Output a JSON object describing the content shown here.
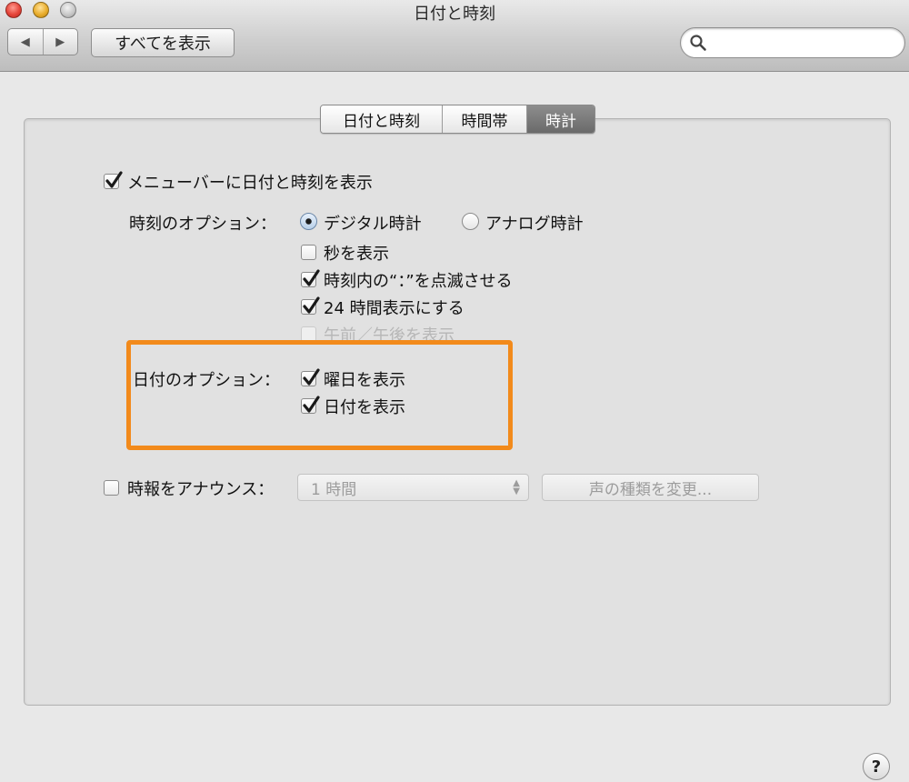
{
  "window": {
    "title": "日付と時刻"
  },
  "toolbar": {
    "back_icon": "◀",
    "forward_icon": "▶",
    "show_all_label": "すべてを表示",
    "search_placeholder": "",
    "search_value": ""
  },
  "tabs": [
    {
      "label": "日付と時刻",
      "active": false
    },
    {
      "label": "時間帯",
      "active": false
    },
    {
      "label": "時計",
      "active": true
    }
  ],
  "clock": {
    "menubar_checkbox": {
      "label": "メニューバーに日付と時刻を表示",
      "checked": true
    },
    "time_options_label": "時刻のオプション：",
    "digital_radio": {
      "label": "デジタル時計",
      "selected": true
    },
    "analog_radio": {
      "label": "アナログ時計",
      "selected": false
    },
    "show_seconds": {
      "label": "秒を表示",
      "checked": false
    },
    "flash_separators": {
      "label": "時刻内の“：”を点滅させる",
      "checked": true
    },
    "use_24_hour": {
      "label": "24 時間表示にする",
      "checked": true
    },
    "show_ampm": {
      "label": "午前／午後を表示",
      "checked": false,
      "disabled": true
    },
    "date_options_label": "日付のオプション：",
    "show_day_of_week": {
      "label": "曜日を表示",
      "checked": true
    },
    "show_date": {
      "label": "日付を表示",
      "checked": true
    },
    "announce_time": {
      "label": "時報をアナウンス：",
      "checked": false
    },
    "announce_interval": {
      "value": "1 時間",
      "disabled": true
    },
    "customize_voice_label": "声の種類を変更..."
  },
  "help_label": "?",
  "colors": {
    "highlight": "#f28a1b",
    "checkbox_check": "#1a1a1a",
    "active_tab": "#7a7a7a"
  }
}
